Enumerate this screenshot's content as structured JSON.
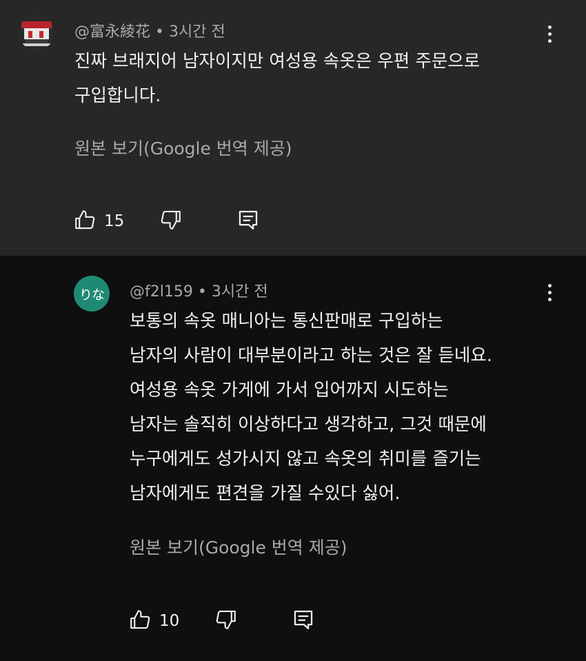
{
  "comments": [
    {
      "handle": "@富永綾花",
      "time": "3시간 전",
      "lines": [
        "진짜 브래지어 남자이지만 여성용 속옷은 우편 주문으로",
        "구입합니다."
      ],
      "translate_label": "원본 보기(Google 번역 제공)",
      "likes": "15"
    },
    {
      "avatar_text": "りな",
      "handle": "@f2l159",
      "time": "3시간 전",
      "lines": [
        "보통의 속옷 매니아는 통신판매로 구입하는",
        "남자의 사람이 대부분이라고 하는 것은 잘 듣네요.",
        "여성용 속옷 가게에 가서 입어까지 시도하는",
        "남자는 솔직히 이상하다고 생각하고, 그것 때문에",
        "누구에게도 성가시지 않고 속옷의 취미를 즐기는",
        "남자에게도 편견을 가질 수있다 싫어."
      ],
      "translate_label": "원본 보기(Google 번역 제공)",
      "likes": "10"
    }
  ],
  "icons": {
    "like": "thumbs-up-icon",
    "dislike": "thumbs-down-icon",
    "reply": "reply-icon",
    "more": "more-vert-icon"
  },
  "colors": {
    "top_background": "#272727",
    "reply_background": "#0f0f0f",
    "avatar_teal": "#1f8a73",
    "secondary_text": "#aaaaaa"
  }
}
